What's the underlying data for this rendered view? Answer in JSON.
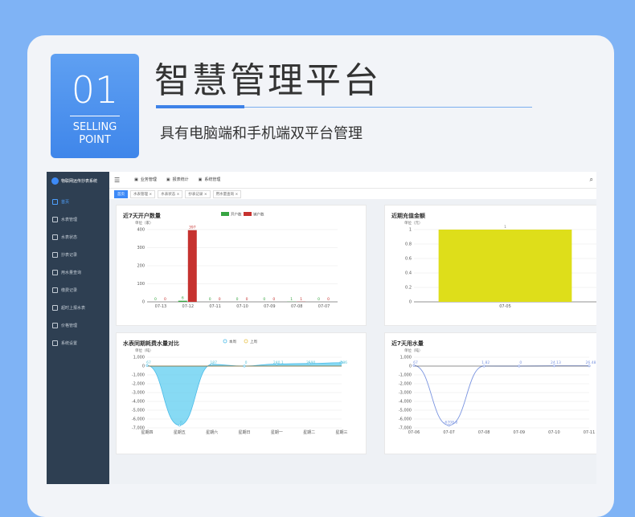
{
  "header": {
    "badge_number": "01",
    "badge_line1": "SELLING",
    "badge_line2": "POINT",
    "title": "智慧管理平台",
    "subtitle": "具有电脑端和手机端双平台管理"
  },
  "app": {
    "brand": "物联网远传抄表系统",
    "sidebar": [
      {
        "label": "首页",
        "icon": "dashboard-icon",
        "active": true
      },
      {
        "label": "水表管理",
        "icon": "meter-icon"
      },
      {
        "label": "水表状态",
        "icon": "status-icon"
      },
      {
        "label": "抄表记录",
        "icon": "record-icon"
      },
      {
        "label": "用水量查询",
        "icon": "query-icon"
      },
      {
        "label": "缴费记录",
        "icon": "yuan-icon"
      },
      {
        "label": "超时上报水表",
        "icon": "clock-icon"
      },
      {
        "label": "价格管理",
        "icon": "price-icon"
      },
      {
        "label": "系统设置",
        "icon": "settings-icon"
      }
    ],
    "top_tabs": [
      {
        "label": "业务管理",
        "active": true
      },
      {
        "label": "报表统计"
      },
      {
        "label": "系统管理"
      }
    ],
    "tags": [
      {
        "label": "首页",
        "active": true
      },
      {
        "label": "水表管理 ×"
      },
      {
        "label": "水表状态 ×"
      },
      {
        "label": "抄表记录 ×"
      },
      {
        "label": "用水量查询 ×"
      }
    ]
  },
  "colors": {
    "accent": "#3d8af7",
    "green": "#37a542",
    "red": "#c6322f",
    "yellow": "#dede1a",
    "cyan": "#5fcdf0",
    "blue_line": "#7a94e0"
  },
  "chart_data": [
    {
      "type": "bar",
      "title": "近7天开户数量",
      "unit": "单位（家）",
      "categories": [
        "07-13",
        "07-12",
        "07-11",
        "07-10",
        "07-09",
        "07-08",
        "07-07"
      ],
      "series": [
        {
          "name": "开户数",
          "values": [
            0,
            6,
            0,
            0,
            0,
            1,
            0
          ]
        },
        {
          "name": "销户数",
          "values": [
            0,
            397,
            0,
            0,
            0,
            1,
            0
          ]
        }
      ],
      "ylim": [
        0,
        400
      ],
      "yticks": [
        0,
        100,
        200,
        300,
        400
      ],
      "value_labels": [
        "0",
        "0",
        "6",
        "397",
        "0",
        "0",
        "0",
        "0",
        "0",
        "0",
        "1",
        "1",
        "0",
        "0"
      ]
    },
    {
      "type": "bar",
      "title": "近期充值金额",
      "unit": "单位（元）",
      "categories": [
        "07-05"
      ],
      "values": [
        1
      ],
      "ylim": [
        0,
        1
      ],
      "yticks": [
        "0",
        "0.2",
        "0.4",
        "0.6",
        "0.8",
        "1"
      ],
      "value_labels": [
        "1"
      ]
    },
    {
      "type": "area",
      "title": "水表同期耗费水量对比",
      "unit": "单位（吨）",
      "categories": [
        "星期四",
        "星期五",
        "星期六",
        "星期日",
        "星期一",
        "星期二",
        "星期三"
      ],
      "series": [
        {
          "name": "本周",
          "values": [
            67,
            -6700,
            187,
            0,
            240,
            290,
            386
          ]
        },
        {
          "name": "上周",
          "values": [
            0,
            0,
            0,
            0,
            0,
            0,
            0
          ]
        }
      ],
      "ylim": [
        -7000,
        1000
      ],
      "yticks": [
        "1,000",
        "0",
        "-1,000",
        "-2,000",
        "-3,000",
        "-4,000",
        "-5,000",
        "-6,000",
        "-7,000"
      ],
      "value_labels": [
        "67",
        "0",
        "187",
        "0",
        "240.1",
        "2590",
        "/386"
      ]
    },
    {
      "type": "line",
      "title": "近7天用水量",
      "unit": "单位（吨）",
      "categories": [
        "07-06",
        "07-07",
        "07-08",
        "07-09",
        "07-10",
        "07-11"
      ],
      "values": [
        67,
        -6700,
        1.82,
        0,
        24.13,
        26.48
      ],
      "ylim": [
        -7000,
        1000
      ],
      "yticks": [
        "1,000",
        "0",
        "-1,000",
        "-2,000",
        "-3,000",
        "-4,000",
        "-5,000",
        "-6,000",
        "-7,000"
      ],
      "value_labels": [
        "67",
        "-6708.8",
        "1.82",
        "0",
        "24.13",
        "26.48"
      ]
    }
  ]
}
